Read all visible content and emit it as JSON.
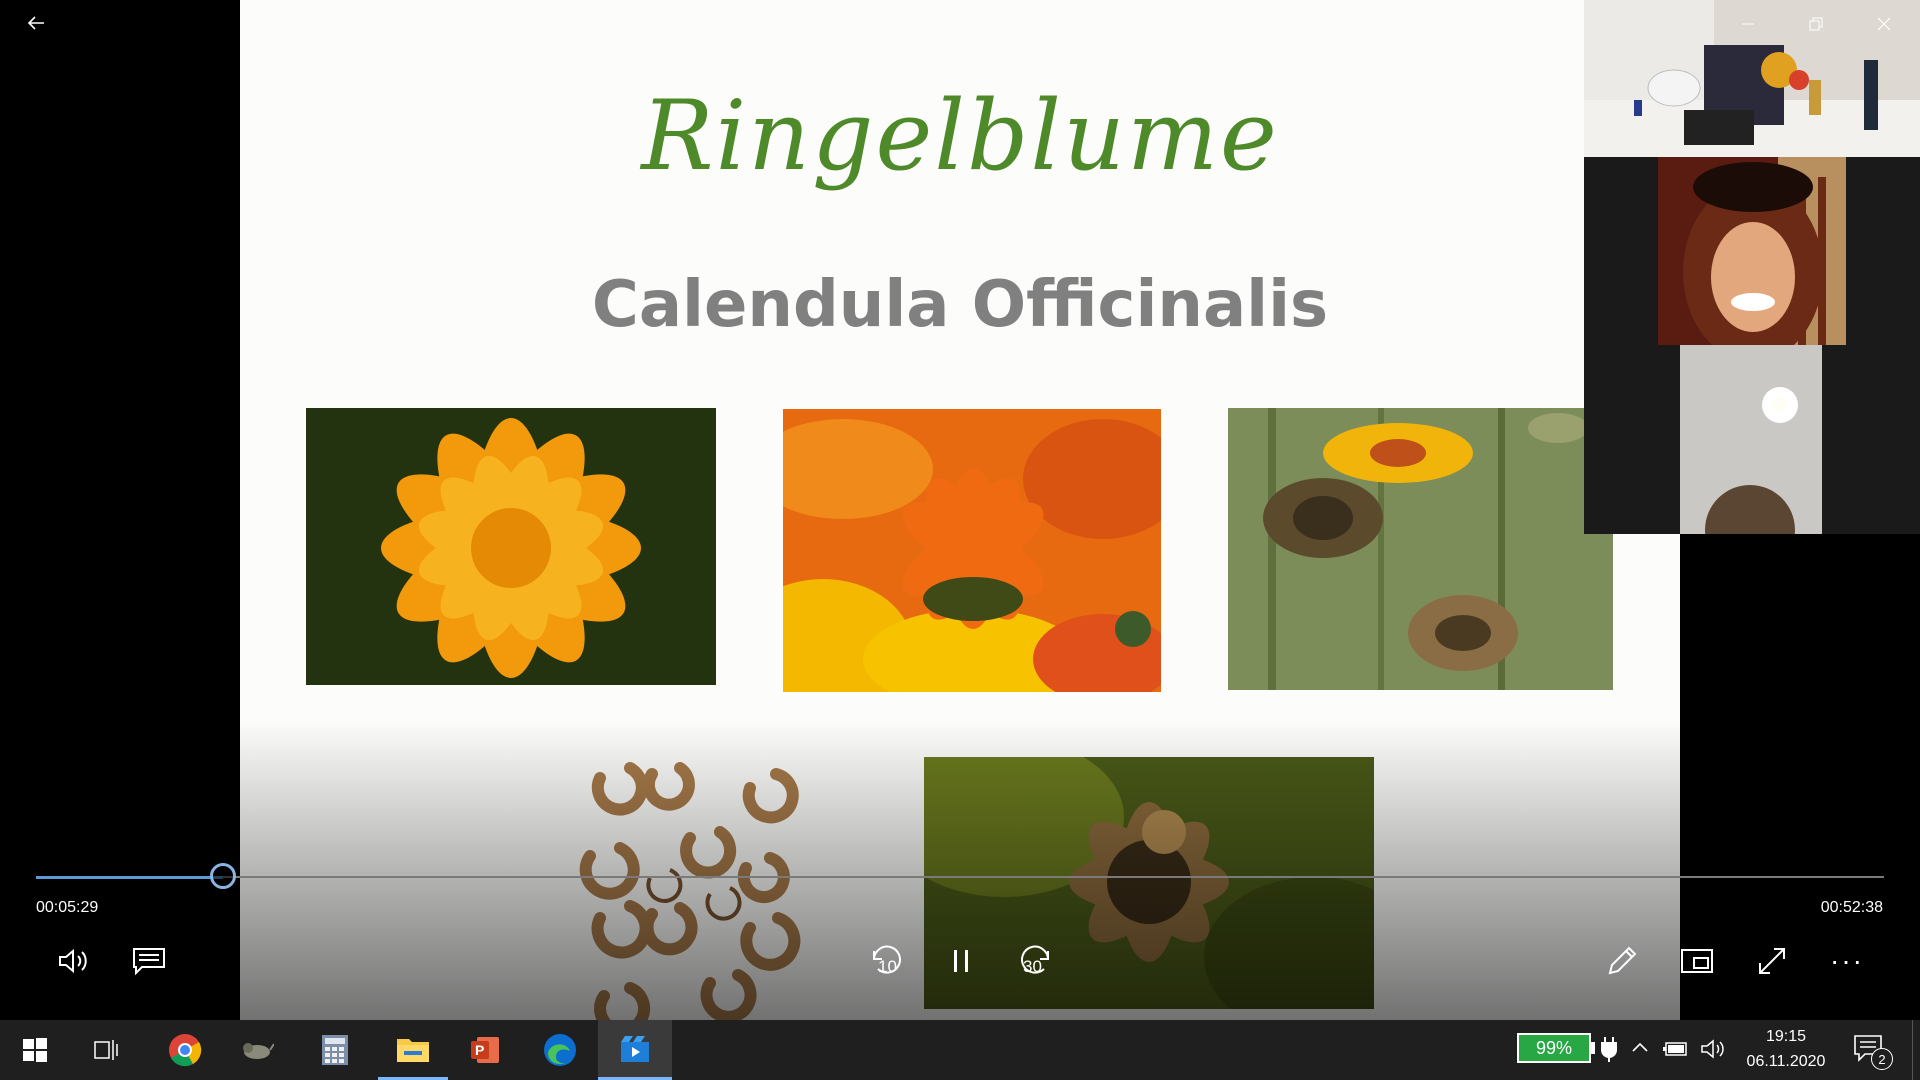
{
  "slide": {
    "title": "Ringelblume",
    "subtitle": "Calendula Officinalis",
    "photos": [
      "marigold-close-up",
      "orange-marigold-field",
      "marigold-seed-heads",
      "calendula-seeds",
      "dried-seed-head"
    ]
  },
  "player": {
    "elapsed": "00:05:29",
    "total": "00:52:38",
    "progress": 0.101,
    "skip_back_label": "10",
    "skip_forward_label": "30",
    "more_label": "···"
  },
  "taskbar": {
    "battery_percent": "99%",
    "time": "19:15",
    "date": "06.11.2020",
    "notification_count": "2"
  },
  "colors": {
    "title_green": "#4f8a2a",
    "subtitle_gray": "#808080",
    "accent_blue": "#5b9bd5",
    "battery_green": "#27a844"
  },
  "icons": [
    "back-arrow-icon",
    "minimize-icon",
    "restore-icon",
    "close-icon",
    "volume-icon",
    "captions-icon",
    "rewind-10-icon",
    "pause-icon",
    "forward-30-icon",
    "pen-icon",
    "mini-view-icon",
    "fullscreen-icon",
    "more-icon",
    "windows-start-icon",
    "task-view-icon",
    "chrome-icon",
    "cat-app-icon",
    "calculator-icon",
    "file-explorer-icon",
    "powerpoint-icon",
    "edge-icon",
    "movies-tv-icon",
    "battery-icon",
    "power-plug-icon",
    "chevron-up-icon",
    "battery-saver-icon",
    "speaker-icon",
    "notifications-icon"
  ]
}
